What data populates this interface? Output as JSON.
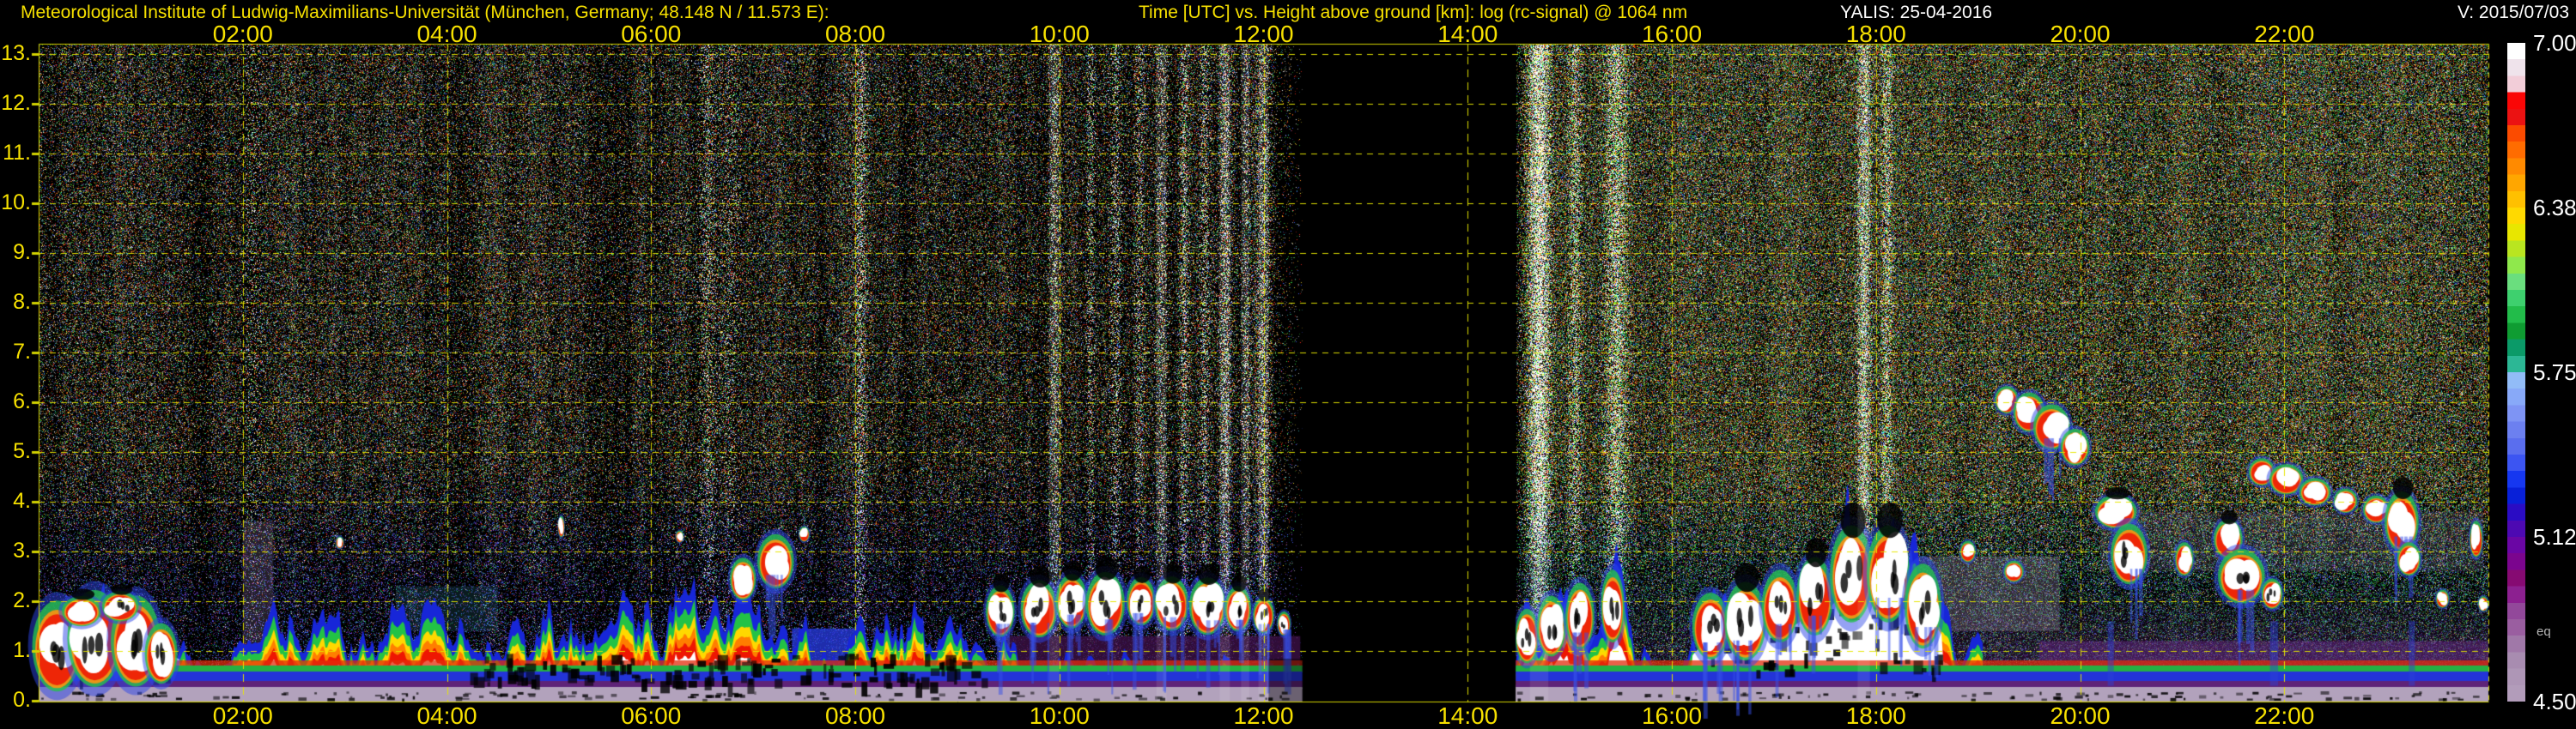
{
  "header": {
    "institute": "Meteorological Institute of Ludwig-Maximilians-Universität (München, Germany; 48.148 N / 11.573 E):",
    "plot_title": "Time [UTC] vs. Height above ground [km]: log (rc-signal) @ 1064 nm",
    "instrument_date": "YALIS: 25-04-2016",
    "version": "V: 2015/07/03"
  },
  "colors": {
    "background": "#000000",
    "label_yellow": "#f6e000",
    "grid": "#e6e600",
    "border": "#d2d200",
    "header_white": "#ffffff",
    "note_gray": "#b4b4b4",
    "ground_band": "#b2a2bc"
  },
  "axes": {
    "x_tick_hours": [
      2,
      4,
      6,
      8,
      10,
      12,
      14,
      16,
      18,
      20,
      22
    ],
    "x_tick_labels": [
      "02:00",
      "04:00",
      "06:00",
      "08:00",
      "10:00",
      "12:00",
      "14:00",
      "16:00",
      "18:00",
      "20:00",
      "22:00"
    ],
    "y_tick_km": [
      0,
      1,
      2,
      3,
      4,
      5,
      6,
      7,
      8,
      9,
      10,
      11,
      12,
      13
    ],
    "y_tick_labels": [
      "0.",
      "1.",
      "2.",
      "3.",
      "4.",
      "5.",
      "6.",
      "7.",
      "8.",
      "9.",
      "10.",
      "11.",
      "12.",
      "13."
    ]
  },
  "colorbar": {
    "tick_labels": [
      "7.00",
      "6.38",
      "5.75",
      "5.12",
      "4.50"
    ],
    "tick_fractions": [
      0,
      0.25,
      0.5,
      0.75,
      1
    ],
    "unit_note": "eq",
    "colors": [
      "#ffffff",
      "#efe3eb",
      "#f2cdd8",
      "#fa0606",
      "#eb1212",
      "#fb4b00",
      "#ff6c00",
      "#ff8a00",
      "#ffa600",
      "#ffc000",
      "#ffd900",
      "#e8e600",
      "#b9e520",
      "#8fe84c",
      "#6ade7e",
      "#3ed06e",
      "#22bc4a",
      "#0f9c32",
      "#0b9a68",
      "#2cb795",
      "#92bcf7",
      "#88a9f8",
      "#7e94f4",
      "#6c80f0",
      "#5a6eee",
      "#3c55f2",
      "#1637f0",
      "#0820d8",
      "#2a0cc4",
      "#4d09b2",
      "#6a06a4",
      "#7b058e",
      "#860a72",
      "#8c2090",
      "#92489a",
      "#9a5ea0",
      "#a078a8",
      "#a88cb0",
      "#ae96b6",
      "#b29cba"
    ]
  },
  "chart_data": {
    "type": "heatmap",
    "title": "log (rc-signal) @ 1064 nm, YALIS lidar, 25-04-2016",
    "xlabel": "Time [UTC]",
    "ylabel": "Height above ground [km]",
    "x_range_hours": [
      0,
      24
    ],
    "y_range_km": [
      0,
      13.2
    ],
    "grid": true,
    "x_gridline_step_hours": 2,
    "y_gridline_step_km": 1,
    "color_scale": {
      "label": "log (rc-signal)",
      "min": 4.5,
      "max": 7.0,
      "ticks": [
        7.0,
        6.38,
        5.75,
        5.12,
        4.5
      ]
    },
    "data_gap_hours": [
      12.38,
      14.47
    ],
    "description": "Photon-count noise speckle aloft; aerosol boundary layer 0-2 km with white/red/green plumes; broken cumulus 09:30-12:20 at ~2 km; black data gap 12:23-14:28; convective clouds 14:30-18:40 up to 3.2 km; purple moist haze and mid-level clouds 3-6 km from 19:15 to 24:00; bright solar-background streaks; gray-mauve ground band.",
    "features": {
      "bl_top_km": [
        [
          0,
          1.5
        ],
        [
          0.3,
          1.6
        ],
        [
          0.7,
          1.55
        ],
        [
          1.1,
          1.3
        ],
        [
          1.35,
          1.05
        ],
        [
          1.6,
          0.75
        ],
        [
          1.9,
          0.7
        ],
        [
          2.1,
          1.15
        ],
        [
          2.35,
          1.5
        ],
        [
          2.6,
          1.1
        ],
        [
          2.85,
          1.45
        ],
        [
          3.1,
          1.15
        ],
        [
          3.35,
          1.5
        ],
        [
          3.6,
          1.2
        ],
        [
          3.85,
          1.45
        ],
        [
          4.1,
          1.15
        ],
        [
          4.35,
          1.4
        ],
        [
          4.6,
          1.5
        ],
        [
          4.85,
          1.35
        ],
        [
          5.1,
          1.55
        ],
        [
          5.35,
          1.3
        ],
        [
          5.6,
          1.5
        ],
        [
          5.85,
          1.6
        ],
        [
          6.1,
          1.35
        ],
        [
          6.35,
          1.6
        ],
        [
          6.6,
          1.8
        ],
        [
          6.9,
          2.3
        ],
        [
          7.1,
          1.7
        ],
        [
          7.35,
          1.2
        ],
        [
          7.6,
          1.05
        ],
        [
          7.85,
          1.15
        ],
        [
          8.1,
          1.6
        ],
        [
          8.35,
          1.9
        ],
        [
          8.6,
          1.7
        ],
        [
          8.85,
          1.5
        ],
        [
          9.1,
          1.25
        ],
        [
          9.35,
          0.95
        ],
        [
          9.6,
          0.8
        ],
        [
          10,
          0.75
        ],
        [
          10.5,
          0.7
        ],
        [
          11,
          0.65
        ],
        [
          11.5,
          0.6
        ],
        [
          12,
          0.55
        ],
        [
          12.36,
          0.5
        ],
        [
          14.47,
          1.3
        ],
        [
          14.6,
          1.8
        ],
        [
          14.75,
          1.4
        ],
        [
          14.95,
          1.9
        ],
        [
          15.15,
          1.5
        ],
        [
          15.35,
          2.0
        ],
        [
          15.5,
          2.2
        ],
        [
          15.65,
          1.0
        ],
        [
          15.9,
          0.75
        ],
        [
          16.1,
          0.8
        ],
        [
          16.3,
          1.4
        ],
        [
          16.5,
          1.7
        ],
        [
          16.7,
          1.5
        ],
        [
          16.9,
          1.9
        ],
        [
          17.1,
          1.7
        ],
        [
          17.3,
          2.0
        ],
        [
          17.55,
          2.3
        ],
        [
          17.8,
          2.9
        ],
        [
          18.0,
          2.7
        ],
        [
          18.2,
          2.9
        ],
        [
          18.45,
          2.3
        ],
        [
          18.65,
          1.6
        ],
        [
          18.85,
          1.1
        ],
        [
          19.05,
          0.85
        ],
        [
          19.3,
          0.7
        ],
        [
          24,
          0.55
        ]
      ],
      "sun_streaks": [
        [
          2.1,
          0.08,
          0.3
        ],
        [
          6.55,
          0.09,
          0.45
        ],
        [
          6.78,
          0.07,
          0.35
        ],
        [
          8.05,
          0.05,
          0.7
        ],
        [
          9.95,
          0.05,
          0.8
        ],
        [
          10.3,
          0.04,
          0.6
        ],
        [
          10.55,
          0.05,
          0.75
        ],
        [
          10.78,
          0.04,
          0.55
        ],
        [
          11.0,
          0.05,
          0.85
        ],
        [
          11.22,
          0.04,
          0.65
        ],
        [
          11.42,
          0.04,
          0.75
        ],
        [
          11.62,
          0.05,
          0.95
        ],
        [
          11.82,
          0.04,
          0.8
        ],
        [
          12.0,
          0.05,
          1.0
        ],
        [
          14.7,
          0.09,
          1.35
        ],
        [
          15.05,
          0.06,
          0.6
        ],
        [
          15.45,
          0.1,
          0.7
        ],
        [
          17.88,
          0.06,
          0.85
        ],
        [
          18.1,
          0.05,
          0.6
        ]
      ],
      "clouds": {
        "left_mass": [
          [
            0.18,
            1.1,
            0.38,
            1.5,
            "m"
          ],
          [
            0.55,
            1.25,
            0.42,
            1.6,
            "m"
          ],
          [
            0.95,
            1.2,
            0.38,
            1.5,
            "m"
          ],
          [
            0.42,
            1.8,
            0.3,
            0.5,
            "s"
          ],
          [
            0.8,
            1.9,
            0.28,
            0.5,
            "sm"
          ],
          [
            1.2,
            0.95,
            0.25,
            1.0,
            "m"
          ]
        ],
        "left_detached": [
          [
            6.9,
            2.45,
            0.2,
            0.7,
            ""
          ],
          [
            7.22,
            2.8,
            0.28,
            0.9,
            "v"
          ],
          [
            7.5,
            3.35,
            0.08,
            0.25,
            ""
          ],
          [
            6.28,
            3.3,
            0.06,
            0.2,
            ""
          ],
          [
            2.95,
            3.18,
            0.06,
            0.2,
            ""
          ],
          [
            5.12,
            3.5,
            0.05,
            0.35,
            ""
          ]
        ],
        "left_broken": [
          [
            9.42,
            1.8,
            0.22,
            0.85,
            "svm"
          ],
          [
            9.8,
            1.85,
            0.28,
            0.95,
            "svm"
          ],
          [
            10.12,
            2.0,
            0.24,
            0.9,
            "svm"
          ],
          [
            10.45,
            1.95,
            0.3,
            1.05,
            "svm"
          ],
          [
            10.8,
            2.0,
            0.22,
            0.8,
            "svm"
          ],
          [
            11.1,
            1.95,
            0.26,
            0.9,
            "svm"
          ],
          [
            11.45,
            1.9,
            0.28,
            0.95,
            "svm"
          ],
          [
            11.75,
            1.85,
            0.2,
            0.75,
            "svm"
          ],
          [
            12.0,
            1.72,
            0.16,
            0.6,
            "svm"
          ],
          [
            12.2,
            1.55,
            0.1,
            0.4,
            "vm"
          ]
        ],
        "right_bl": [
          [
            14.58,
            1.3,
            0.18,
            0.9,
            "m"
          ],
          [
            14.82,
            1.5,
            0.22,
            1.0,
            "m"
          ],
          [
            15.1,
            1.7,
            0.22,
            1.1,
            "vm"
          ],
          [
            15.42,
            1.9,
            0.18,
            1.2,
            "m"
          ],
          [
            16.38,
            1.5,
            0.28,
            1.1,
            "vm"
          ],
          [
            16.72,
            1.6,
            0.32,
            1.3,
            "svm"
          ],
          [
            17.06,
            1.9,
            0.28,
            1.2,
            "vm"
          ],
          [
            17.4,
            2.1,
            0.28,
            1.3,
            "svm"
          ],
          [
            17.76,
            2.55,
            0.33,
            1.6,
            "sm"
          ],
          [
            18.12,
            2.55,
            0.33,
            1.6,
            "svm"
          ],
          [
            18.46,
            1.9,
            0.28,
            1.4,
            "vm"
          ]
        ],
        "right_mid": [
          [
            19.28,
            6.05,
            0.18,
            0.45,
            ""
          ],
          [
            19.5,
            5.8,
            0.24,
            0.65,
            ""
          ],
          [
            19.72,
            5.5,
            0.28,
            0.75,
            "v"
          ],
          [
            19.95,
            5.1,
            0.22,
            0.6,
            ""
          ],
          [
            20.35,
            3.8,
            0.32,
            0.55,
            "s"
          ],
          [
            20.48,
            2.95,
            0.28,
            1.0,
            "vm"
          ],
          [
            21.02,
            2.85,
            0.14,
            0.55,
            ""
          ],
          [
            21.45,
            3.25,
            0.22,
            0.65,
            "s"
          ],
          [
            21.58,
            2.5,
            0.36,
            0.9,
            "vm"
          ],
          [
            21.88,
            2.15,
            0.16,
            0.5,
            "m"
          ],
          [
            21.78,
            4.6,
            0.2,
            0.45,
            ""
          ],
          [
            22.02,
            4.45,
            0.26,
            0.5,
            ""
          ],
          [
            22.3,
            4.2,
            0.24,
            0.45,
            ""
          ],
          [
            22.6,
            4.02,
            0.18,
            0.4,
            ""
          ],
          [
            22.9,
            3.85,
            0.2,
            0.45,
            ""
          ],
          [
            23.15,
            3.6,
            0.26,
            1.0,
            "sv"
          ],
          [
            23.22,
            2.85,
            0.18,
            0.55,
            ""
          ],
          [
            23.55,
            2.05,
            0.1,
            0.3,
            ""
          ],
          [
            23.88,
            3.25,
            0.1,
            0.6,
            ""
          ],
          [
            23.95,
            1.95,
            0.08,
            0.25,
            ""
          ],
          [
            18.9,
            3.0,
            0.12,
            0.35,
            ""
          ],
          [
            19.35,
            2.6,
            0.15,
            0.35,
            ""
          ]
        ]
      },
      "haze_regions": [
        {
          "t": [
            7.38,
            8.08
          ],
          "km": [
            0,
            1.45
          ],
          "color": "rgba(40,60,230,0.75)",
          "grad": false
        },
        {
          "t": [
            9.45,
            12.36
          ],
          "km": [
            0,
            1.3
          ],
          "color": "rgba(60,16,70,0.8)",
          "grad": false
        },
        {
          "t": [
            2.0,
            2.3
          ],
          "km": [
            1.0,
            3.6
          ],
          "color": "rgba(170,140,190,0.22)",
          "grad": false
        },
        {
          "t": [
            3.5,
            4.5
          ],
          "km": [
            1.4,
            2.3
          ],
          "color": "rgba(70,180,210,0.15)",
          "grad": false
        },
        {
          "t": [
            14.47,
            18.6
          ],
          "km": [
            0,
            3.2
          ],
          "color": "rgba(90,30,120,0.35)",
          "grad": true
        },
        {
          "t": [
            14.47,
            24
          ],
          "km": [
            0,
            0.9
          ],
          "color": "rgba(50,40,190,0.45)",
          "grad": true
        },
        {
          "t": [
            18.6,
            24
          ],
          "km": [
            0,
            2.7
          ],
          "color": "rgba(120,50,150,0.6)",
          "grad": true
        },
        {
          "t": [
            19.6,
            24
          ],
          "km": [
            0,
            1.2
          ],
          "color": "rgba(100,40,130,0.5)",
          "grad": false
        },
        {
          "t": [
            18.4,
            19.8
          ],
          "km": [
            1.4,
            2.9
          ],
          "color": "rgba(160,140,170,0.3)",
          "grad": false
        },
        {
          "t": [
            20.2,
            23.95
          ],
          "km": [
            2.6,
            3.8
          ],
          "color": "rgba(140,120,160,0.18)",
          "grad": false
        }
      ],
      "virga_wisps": [
        [
          20.3,
          0.06
        ],
        [
          21.9,
          0.08
        ],
        [
          23.25,
          0.06
        ]
      ]
    }
  }
}
